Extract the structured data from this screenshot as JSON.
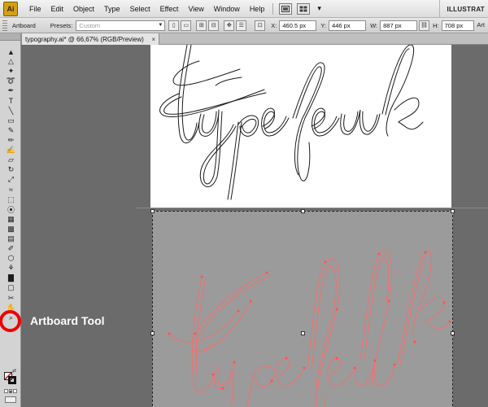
{
  "app": {
    "logo": "Ai",
    "brand": "ILLUSTRAT",
    "accent": "#d4a017"
  },
  "menu": {
    "items": [
      "File",
      "Edit",
      "Object",
      "Type",
      "Select",
      "Effect",
      "View",
      "Window",
      "Help"
    ],
    "icons": [
      "bridge-icon",
      "arrange-documents-icon"
    ]
  },
  "control_bar": {
    "artboard_label": "Artboard",
    "presets_label": "Presets:",
    "presets_value": "Custom",
    "x_label": "X:",
    "x_value": "460.5 px",
    "y_label": "Y:",
    "y_value": "446 px",
    "w_label": "W:",
    "w_value": "887 px",
    "h_label": "H:",
    "h_value": "708 px",
    "right_label": "Art"
  },
  "document": {
    "tab_title": "typography.ai* @ 66,67% (RGB/Preview)"
  },
  "tools": {
    "items": [
      {
        "name": "selection-tool",
        "glyph": "▲"
      },
      {
        "name": "direct-selection-tool",
        "glyph": "△"
      },
      {
        "name": "magic-wand-tool",
        "glyph": "✦"
      },
      {
        "name": "lasso-tool",
        "glyph": "➰"
      },
      {
        "name": "pen-tool",
        "glyph": "✒"
      },
      {
        "name": "type-tool",
        "glyph": "T"
      },
      {
        "name": "line-tool",
        "glyph": "╲"
      },
      {
        "name": "rectangle-tool",
        "glyph": "▭"
      },
      {
        "name": "paintbrush-tool",
        "glyph": "✎"
      },
      {
        "name": "pencil-tool",
        "glyph": "✏"
      },
      {
        "name": "blob-brush-tool",
        "glyph": "✍"
      },
      {
        "name": "eraser-tool",
        "glyph": "▱"
      },
      {
        "name": "rotate-tool",
        "glyph": "↻"
      },
      {
        "name": "scale-tool",
        "glyph": "⤢"
      },
      {
        "name": "width-tool",
        "glyph": "≈"
      },
      {
        "name": "free-transform-tool",
        "glyph": "⬚"
      },
      {
        "name": "shape-builder-tool",
        "glyph": "⦿"
      },
      {
        "name": "perspective-grid-tool",
        "glyph": "▦"
      },
      {
        "name": "mesh-tool",
        "glyph": "▩"
      },
      {
        "name": "gradient-tool",
        "glyph": "▤"
      },
      {
        "name": "eyedropper-tool",
        "glyph": "✐"
      },
      {
        "name": "blend-tool",
        "glyph": "⬡"
      },
      {
        "name": "symbol-sprayer-tool",
        "glyph": "⚘"
      },
      {
        "name": "column-graph-tool",
        "glyph": "▇"
      },
      {
        "name": "artboard-tool",
        "glyph": "▢"
      },
      {
        "name": "slice-tool",
        "glyph": "✂"
      },
      {
        "name": "hand-tool",
        "glyph": "✋"
      },
      {
        "name": "zoom-tool",
        "glyph": "⌕"
      }
    ]
  },
  "annotation": {
    "label": "Artboard Tool",
    "color": "#ee0000"
  }
}
